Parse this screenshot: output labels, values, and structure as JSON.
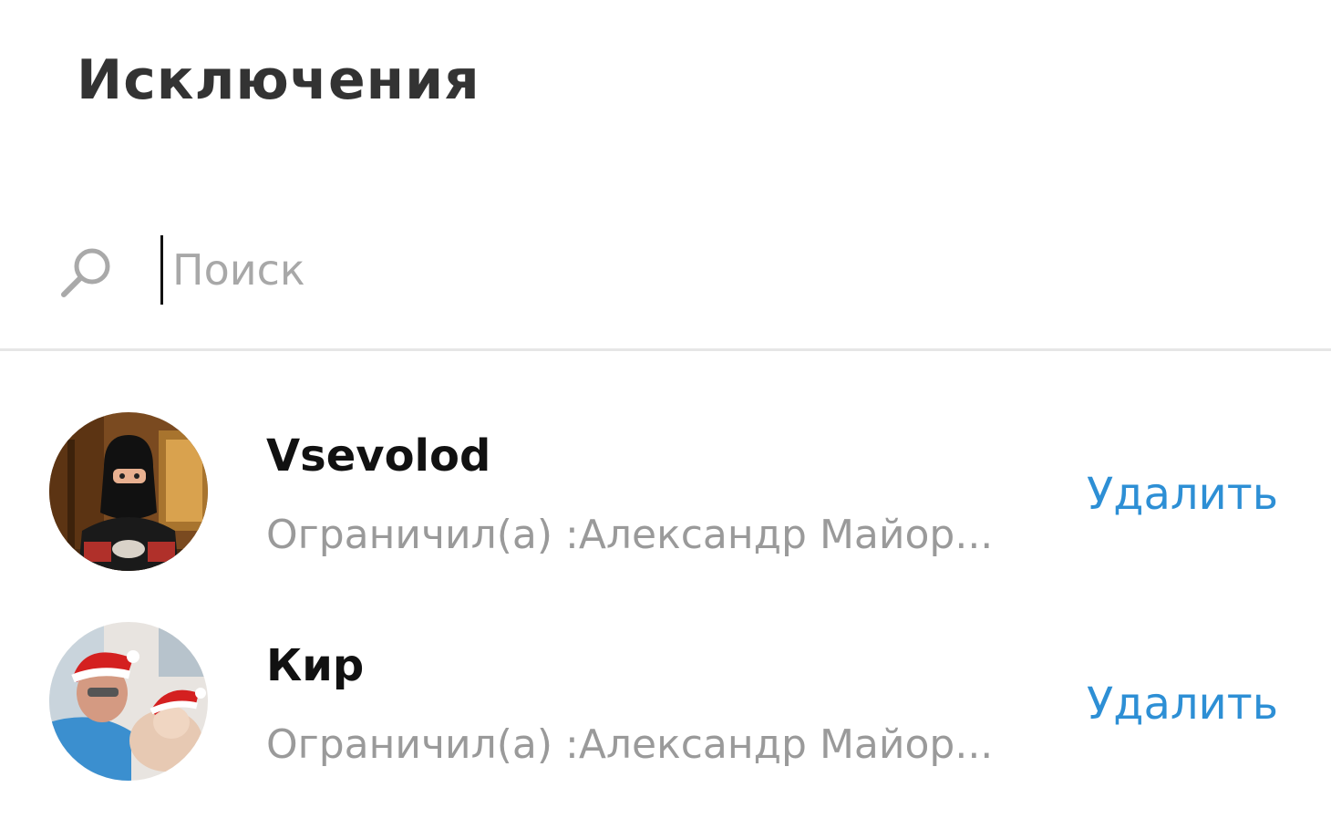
{
  "header": {
    "title": "Исключения"
  },
  "search": {
    "placeholder": "Поиск",
    "value": "",
    "icon": "search-icon"
  },
  "exceptions": [
    {
      "name": "Vsevolod",
      "subtitle": "Ограничил(а) :Александр Майор...",
      "action_label": "Удалить",
      "avatar": "avatar-photo"
    },
    {
      "name": "Кир",
      "subtitle": "Ограничил(а) :Александр Майор...",
      "action_label": "Удалить",
      "avatar": "avatar-photo"
    }
  ],
  "colors": {
    "accent": "#2d8fd5",
    "title": "#333333",
    "subtitle": "#9a9a9a",
    "divider": "#e6e6e6"
  }
}
